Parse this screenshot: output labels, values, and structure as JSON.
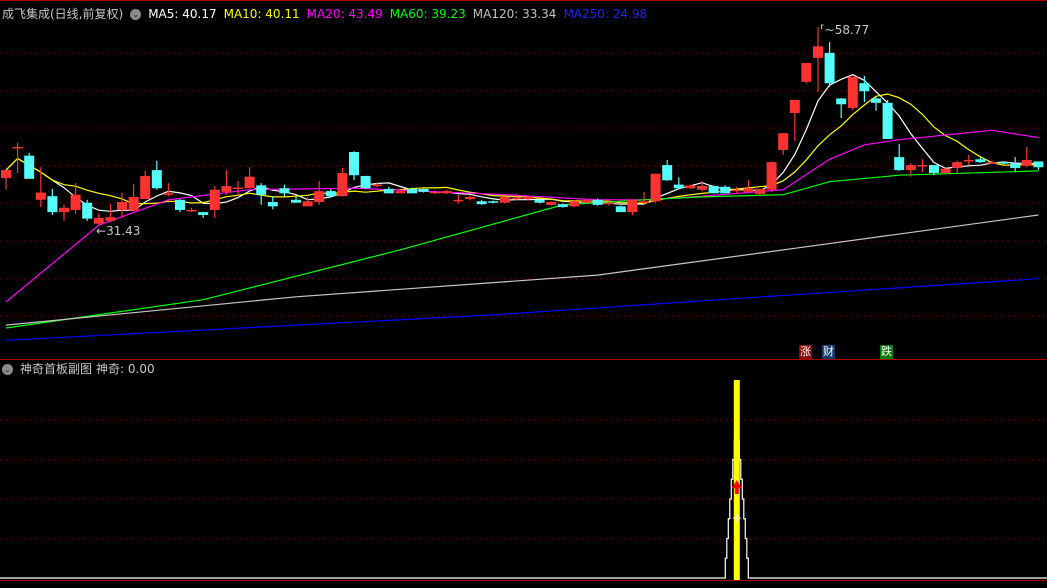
{
  "header": {
    "title": "成飞集成(日线,前复权)",
    "ma": [
      {
        "label": "MA5: 40.17",
        "color": "#ffffff"
      },
      {
        "label": "MA10: 40.11",
        "color": "#ffff00"
      },
      {
        "label": "MA20: 43.49",
        "color": "#ff00ff"
      },
      {
        "label": "MA60: 39.23",
        "color": "#00ff00"
      },
      {
        "label": "MA120: 33.34",
        "color": "#c0c0c0"
      },
      {
        "label": "MA250: 24.98",
        "color": "#0000ff"
      }
    ]
  },
  "sub_header": {
    "title": "神奇首板副图",
    "indicator": "神奇: 0.00"
  },
  "markers": [
    {
      "text": "涨",
      "color": "#8b0a0a"
    },
    {
      "text": "财",
      "color": "#123a6a"
    },
    {
      "text": "跌",
      "color": "#0a7a0a"
    }
  ],
  "colors": {
    "up": "#ff3232",
    "down": "#54fcfc",
    "grid": "#8b0000",
    "signal": "#ffff00"
  },
  "chart_data": [
    {
      "type": "candlestick",
      "title": "成飞集成(日线,前复权)",
      "ylim": [
        13.05,
        62.5
      ],
      "annotations": {
        "high": "58.77",
        "low": "31.43"
      },
      "ohlc": [
        [
          37.9,
          39.0,
          36.3,
          39.0
        ],
        [
          42.1,
          42.8,
          38.6,
          42.2
        ],
        [
          41.0,
          41.4,
          37.8,
          37.8
        ],
        [
          34.9,
          39.4,
          33.9,
          35.9
        ],
        [
          35.4,
          36.4,
          32.8,
          33.2
        ],
        [
          33.2,
          34.2,
          32.0,
          33.8
        ],
        [
          33.5,
          37.2,
          33.0,
          35.6
        ],
        [
          34.5,
          34.9,
          32.0,
          32.3
        ],
        [
          31.6,
          33.0,
          31.43,
          32.4
        ],
        [
          32.0,
          34.3,
          31.8,
          32.5
        ],
        [
          33.5,
          35.9,
          32.4,
          34.6
        ],
        [
          33.4,
          37.1,
          33.4,
          35.3
        ],
        [
          35.0,
          38.9,
          35.0,
          38.2
        ],
        [
          39.0,
          40.3,
          36.3,
          36.5
        ],
        [
          35.7,
          37.2,
          35.4,
          35.8
        ],
        [
          34.9,
          35.0,
          33.2,
          33.5
        ],
        [
          33.5,
          33.8,
          33.2,
          33.5
        ],
        [
          33.2,
          33.2,
          32.4,
          32.8
        ],
        [
          33.5,
          36.8,
          32.4,
          36.3
        ],
        [
          36.0,
          39.0,
          35.6,
          36.8
        ],
        [
          36.5,
          37.5,
          35.4,
          36.6
        ],
        [
          36.5,
          39.4,
          36.5,
          38.1
        ],
        [
          36.9,
          37.2,
          34.2,
          35.6
        ],
        [
          34.6,
          35.4,
          33.6,
          34.0
        ],
        [
          36.5,
          37.0,
          35.4,
          35.8
        ],
        [
          34.9,
          35.3,
          34.5,
          34.5
        ],
        [
          34.0,
          35.3,
          34.0,
          34.7
        ],
        [
          34.6,
          37.5,
          34.2,
          36.1
        ],
        [
          36.1,
          36.4,
          35.3,
          35.4
        ],
        [
          35.4,
          39.3,
          35.4,
          38.6
        ],
        [
          41.5,
          41.6,
          37.6,
          38.3
        ],
        [
          38.2,
          38.2,
          36.4,
          36.5
        ],
        [
          36.9,
          37.3,
          36.6,
          37.0
        ],
        [
          36.4,
          36.7,
          35.8,
          35.8
        ],
        [
          35.8,
          36.3,
          35.8,
          36.1
        ],
        [
          36.4,
          36.6,
          35.8,
          35.8
        ],
        [
          36.4,
          36.6,
          35.9,
          36.0
        ],
        [
          36.0,
          36.2,
          35.7,
          36.0
        ],
        [
          35.8,
          36.3,
          35.7,
          36.1
        ],
        [
          34.8,
          35.6,
          34.4,
          34.9
        ],
        [
          35.0,
          35.5,
          34.8,
          35.3
        ],
        [
          34.7,
          34.9,
          34.2,
          34.3
        ],
        [
          34.7,
          34.8,
          34.4,
          34.5
        ],
        [
          34.5,
          35.3,
          34.4,
          35.3
        ],
        [
          35.1,
          35.7,
          34.9,
          35.2
        ],
        [
          35.0,
          35.5,
          34.9,
          35.3
        ],
        [
          34.9,
          35.0,
          34.4,
          34.5
        ],
        [
          34.2,
          34.7,
          34.1,
          34.6
        ],
        [
          34.3,
          34.4,
          33.8,
          33.9
        ],
        [
          34.0,
          34.8,
          33.9,
          34.7
        ],
        [
          34.5,
          35.0,
          34.4,
          34.9
        ],
        [
          34.9,
          35.1,
          34.1,
          34.2
        ],
        [
          34.4,
          35.0,
          34.1,
          34.5
        ],
        [
          34.0,
          34.1,
          33.2,
          33.2
        ],
        [
          33.2,
          34.9,
          32.8,
          34.9
        ],
        [
          34.6,
          36.0,
          34.3,
          34.7
        ],
        [
          34.7,
          38.5,
          34.5,
          38.5
        ],
        [
          39.7,
          40.4,
          37.5,
          37.6
        ],
        [
          37.0,
          38.0,
          36.4,
          36.5
        ],
        [
          36.5,
          37.0,
          36.4,
          36.9
        ],
        [
          36.3,
          37.5,
          36.1,
          36.8
        ],
        [
          36.8,
          36.9,
          35.8,
          35.8
        ],
        [
          36.7,
          36.9,
          35.8,
          35.8
        ],
        [
          36.2,
          36.7,
          35.8,
          36.3
        ],
        [
          36.0,
          37.6,
          35.9,
          36.5
        ],
        [
          35.7,
          36.4,
          35.6,
          36.4
        ],
        [
          36.3,
          40.2,
          36.0,
          40.1
        ],
        [
          41.8,
          44.1,
          41.1,
          44.1
        ],
        [
          46.9,
          48.7,
          43.0,
          48.7
        ],
        [
          51.2,
          53.8,
          51.0,
          53.8
        ],
        [
          54.5,
          58.77,
          49.8,
          56.1
        ],
        [
          55.2,
          56.7,
          50.5,
          51.0
        ],
        [
          48.9,
          48.95,
          46.2,
          48.1
        ],
        [
          47.6,
          51.9,
          47.3,
          51.9
        ],
        [
          51.0,
          52.0,
          48.4,
          49.9
        ],
        [
          48.9,
          49.2,
          47.2,
          48.3
        ],
        [
          48.3,
          48.7,
          43.3,
          43.3
        ],
        [
          40.8,
          42.6,
          38.9,
          39.0
        ],
        [
          39.0,
          40.0,
          38.1,
          39.7
        ],
        [
          39.6,
          40.5,
          38.7,
          39.7
        ],
        [
          39.7,
          39.7,
          38.3,
          38.6
        ],
        [
          38.6,
          39.3,
          38.6,
          39.2
        ],
        [
          39.3,
          40.3,
          38.6,
          40.1
        ],
        [
          40.2,
          41.1,
          39.7,
          40.4
        ],
        [
          40.5,
          40.8,
          40.0,
          40.1
        ],
        [
          40.1,
          40.3,
          40.0,
          40.1
        ],
        [
          40.1,
          40.2,
          39.8,
          39.9
        ],
        [
          39.9,
          40.8,
          38.7,
          39.3
        ],
        [
          39.6,
          42.2,
          39.4,
          40.4
        ],
        [
          40.2,
          40.2,
          39.0,
          39.4
        ]
      ],
      "series": [
        {
          "name": "MA5",
          "window": 5
        },
        {
          "name": "MA10",
          "window": 10
        },
        {
          "name": "MA20",
          "points": [
            [
              0,
              20.8
            ],
            [
              8,
              31.4
            ],
            [
              14,
              34.9
            ],
            [
              21,
              36.3
            ],
            [
              30,
              36.5
            ],
            [
              43,
              35.6
            ],
            [
              51,
              34.9
            ],
            [
              55,
              34.9
            ],
            [
              60,
              35.4
            ],
            [
              67,
              36.3
            ],
            [
              71,
              40.5
            ],
            [
              74,
              42.5
            ],
            [
              77,
              43.2
            ],
            [
              85,
              44.5
            ],
            [
              89,
              43.5
            ]
          ]
        },
        {
          "name": "MA60",
          "points": [
            [
              0,
              17.2
            ],
            [
              17,
              21.1
            ],
            [
              34,
              28.0
            ],
            [
              48,
              34.2
            ],
            [
              55,
              34.9
            ],
            [
              60,
              35.3
            ],
            [
              67,
              35.6
            ],
            [
              71,
              37.4
            ],
            [
              77,
              38.3
            ],
            [
              89,
              38.9
            ]
          ]
        },
        {
          "name": "MA120",
          "points": [
            [
              0,
              17.6
            ],
            [
              25,
              21.5
            ],
            [
              51,
              24.5
            ],
            [
              68,
              28.2
            ],
            [
              89,
              32.8
            ]
          ]
        },
        {
          "name": "MA250",
          "points": [
            [
              0,
              15.5
            ],
            [
              42,
              19.0
            ],
            [
              68,
              21.8
            ],
            [
              89,
              24.0
            ]
          ]
        }
      ]
    },
    {
      "type": "bar",
      "title": "神奇首板副图",
      "series": [
        {
          "name": "神奇",
          "value": 0.0,
          "signal_index": 63
        }
      ]
    }
  ]
}
